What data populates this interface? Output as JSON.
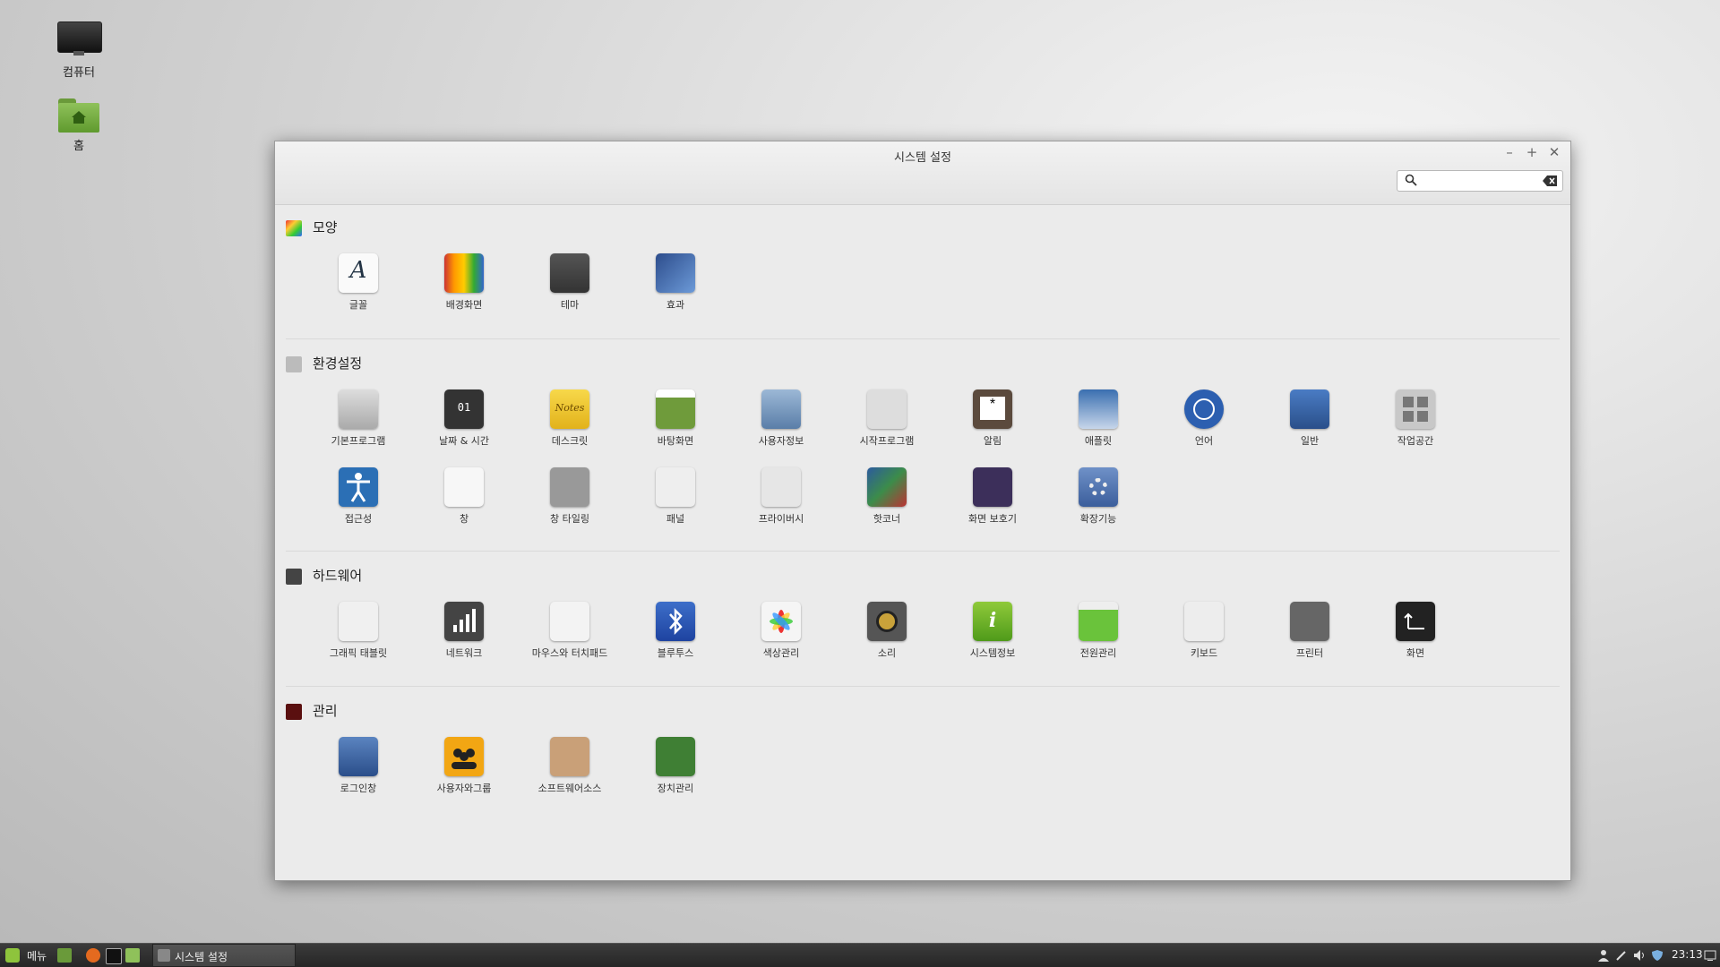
{
  "desktop": {
    "icons": [
      {
        "label": "컴퓨터"
      },
      {
        "label": "홈"
      }
    ]
  },
  "window": {
    "title": "시스템 설정",
    "search": {
      "value": "",
      "placeholder": ""
    },
    "sections": [
      {
        "title": "모양",
        "items": [
          {
            "label": "글꼴",
            "icon": "font-icon"
          },
          {
            "label": "배경화면",
            "icon": "backgrounds-icon"
          },
          {
            "label": "테마",
            "icon": "themes-icon"
          },
          {
            "label": "효과",
            "icon": "effects-icon"
          }
        ]
      },
      {
        "title": "환경설정",
        "items": [
          {
            "label": "기본프로그램",
            "icon": "preferred-apps-icon"
          },
          {
            "label": "날짜 & 시간",
            "icon": "date-time-icon"
          },
          {
            "label": "데스크릿",
            "icon": "desklets-icon"
          },
          {
            "label": "바탕화면",
            "icon": "desktop-icon"
          },
          {
            "label": "사용자정보",
            "icon": "account-details-icon"
          },
          {
            "label": "시작프로그램",
            "icon": "startup-apps-icon"
          },
          {
            "label": "알림",
            "icon": "notifications-icon"
          },
          {
            "label": "애플릿",
            "icon": "applets-icon"
          },
          {
            "label": "언어",
            "icon": "languages-icon"
          },
          {
            "label": "일반",
            "icon": "general-icon"
          },
          {
            "label": "작업공간",
            "icon": "workspaces-icon"
          },
          {
            "label": "접근성",
            "icon": "accessibility-icon"
          },
          {
            "label": "창",
            "icon": "windows-icon"
          },
          {
            "label": "창 타일링",
            "icon": "window-tiling-icon"
          },
          {
            "label": "패널",
            "icon": "panel-icon"
          },
          {
            "label": "프라이버시",
            "icon": "privacy-icon"
          },
          {
            "label": "핫코너",
            "icon": "hot-corners-icon"
          },
          {
            "label": "화면 보호기",
            "icon": "screensaver-icon"
          },
          {
            "label": "확장기능",
            "icon": "extensions-icon"
          }
        ]
      },
      {
        "title": "하드웨어",
        "items": [
          {
            "label": "그래픽 태블릿",
            "icon": "graphics-tablet-icon"
          },
          {
            "label": "네트워크",
            "icon": "network-icon"
          },
          {
            "label": "마우스와 터치패드",
            "icon": "mouse-icon"
          },
          {
            "label": "블루투스",
            "icon": "bluetooth-icon"
          },
          {
            "label": "색상관리",
            "icon": "color-icon"
          },
          {
            "label": "소리",
            "icon": "sound-icon"
          },
          {
            "label": "시스템정보",
            "icon": "system-info-icon"
          },
          {
            "label": "전원관리",
            "icon": "power-icon"
          },
          {
            "label": "키보드",
            "icon": "keyboard-icon"
          },
          {
            "label": "프린터",
            "icon": "printers-icon"
          },
          {
            "label": "화면",
            "icon": "display-icon"
          }
        ]
      },
      {
        "title": "관리",
        "items": [
          {
            "label": "로그인창",
            "icon": "login-window-icon"
          },
          {
            "label": "사용자와그룹",
            "icon": "users-groups-icon"
          },
          {
            "label": "소프트웨어소스",
            "icon": "software-sources-icon"
          },
          {
            "label": "장치관리",
            "icon": "driver-manager-icon"
          }
        ]
      }
    ]
  },
  "taskbar": {
    "menu_label": "메뉴",
    "task_label": "시스템 설정",
    "clock": "23:13"
  }
}
